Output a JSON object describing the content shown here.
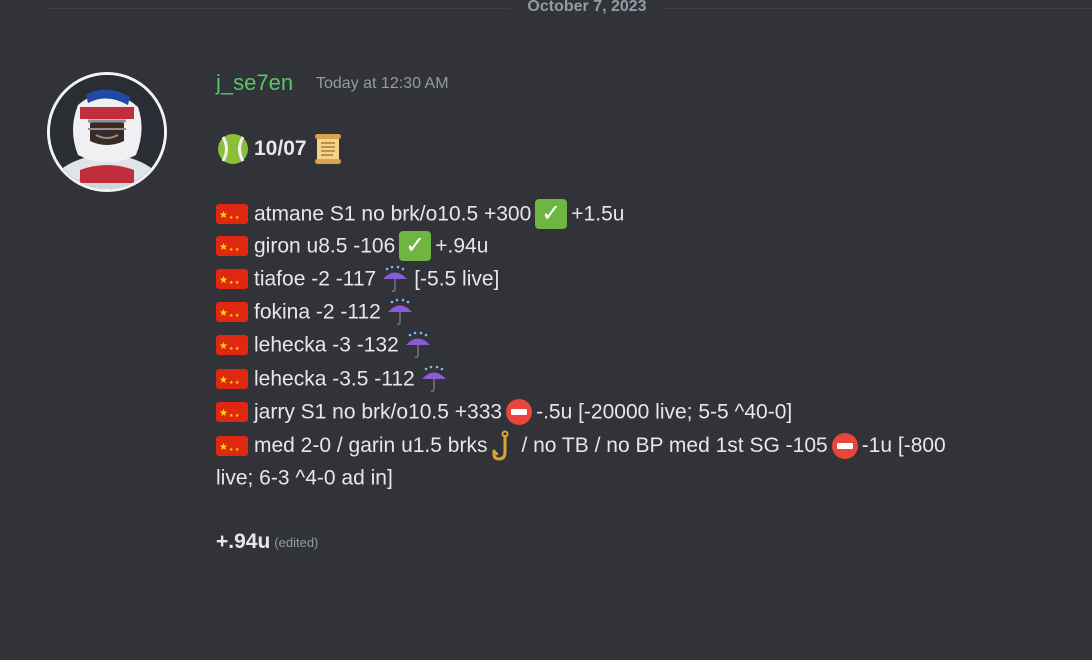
{
  "divider": {
    "date": "October 7, 2023"
  },
  "author": {
    "username": "j_se7en",
    "timestamp": "Today at 12:30 AM"
  },
  "header": {
    "date_code": "10/07"
  },
  "bets": [
    {
      "text": "atmane S1 no brk/o10.5 +300",
      "result_icon": "check-icon",
      "after": "+1.5u"
    },
    {
      "text": "giron u8.5 -106",
      "result_icon": "check-icon",
      "after": "+.94u"
    },
    {
      "text": "tiafoe -2 -117",
      "result_icon": "umbrella-rain-icon",
      "after": "[-5.5 live]"
    },
    {
      "text": "fokina -2 -112",
      "result_icon": "umbrella-rain-icon",
      "after": ""
    },
    {
      "text": "lehecka -3 -132",
      "result_icon": "umbrella-rain-icon",
      "after": ""
    },
    {
      "text": "lehecka -3.5 -112",
      "result_icon": "umbrella-rain-icon",
      "after": ""
    },
    {
      "text": "jarry S1 no brk/o10.5 +333",
      "result_icon": "no-entry-icon",
      "after": "-.5u [-20000 live; 5-5 ^40-0]"
    },
    {
      "text": "med 2-0 / garin u1.5 brks",
      "result_icon": "hook-icon",
      "after": "/ no TB / no BP med 1st SG -105",
      "result_icon_2": "no-entry-icon",
      "after_2": "-1u [-800",
      "continuation": "live; 6-3 ^4-0 ad in]"
    }
  ],
  "summary": {
    "value": "+.94u",
    "edited_label": "(edited)"
  },
  "colors": {
    "background": "#313338",
    "username": "#57c768",
    "muted": "#949ba4",
    "text": "#e6e7ea"
  }
}
